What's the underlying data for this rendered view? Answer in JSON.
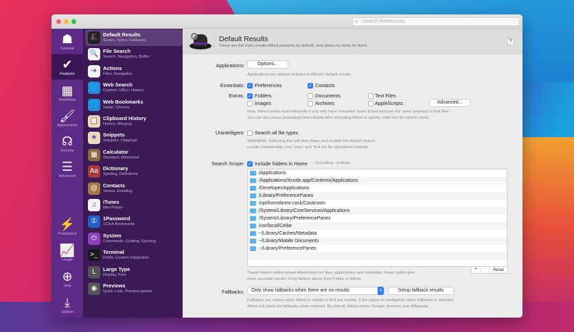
{
  "search": {
    "placeholder": "Search Preferences"
  },
  "iconbar": [
    {
      "label": "General",
      "icon": "hat-icon",
      "glyph": "☗"
    },
    {
      "label": "Features",
      "icon": "checkmark-icon",
      "glyph": "✔"
    },
    {
      "label": "Workflows",
      "icon": "grid-icon",
      "glyph": "▦"
    },
    {
      "label": "Appearance",
      "icon": "paint-roller-icon",
      "glyph": "🖌"
    },
    {
      "label": "Remote",
      "icon": "remote-icon",
      "glyph": "☊"
    },
    {
      "label": "Advanced",
      "icon": "sliders-icon",
      "glyph": "☰"
    },
    {
      "label": "Powerpack",
      "icon": "battery-icon",
      "glyph": "⚡"
    },
    {
      "label": "Usage",
      "icon": "chart-icon",
      "glyph": "📈"
    },
    {
      "label": "Help",
      "icon": "lifebuoy-icon",
      "glyph": "⊕"
    },
    {
      "label": "Update",
      "icon": "download-icon",
      "glyph": "⤓"
    }
  ],
  "features": [
    {
      "title": "Default Results",
      "sub": "Scope, Types, Fallbacks",
      "icon": "alfred-hat-icon",
      "color": "#222222",
      "glyph": "🎩"
    },
    {
      "title": "File Search",
      "sub": "Search, Navigation, Buffer",
      "icon": "file-search-icon",
      "color": "#f2f2f2",
      "glyph": "🔍"
    },
    {
      "title": "Actions",
      "sub": "Files, Navigation",
      "icon": "actions-icon",
      "color": "#f2f2f2",
      "glyph": "➜"
    },
    {
      "title": "Web Search",
      "sub": "Custom, URLs, History",
      "icon": "globe-search-icon",
      "color": "#2a8ad8",
      "glyph": "🌐"
    },
    {
      "title": "Web Bookmarks",
      "sub": "Safari, Chrome",
      "icon": "globe-bookmark-icon",
      "color": "#2a8ad8",
      "glyph": "🌐"
    },
    {
      "title": "Clipboard History",
      "sub": "History, Merging",
      "icon": "clipboard-icon",
      "color": "#e8dcc0",
      "glyph": "📋"
    },
    {
      "title": "Snippets",
      "sub": "Snippets, Clippings",
      "icon": "snippets-icon",
      "color": "#e8dcc0",
      "glyph": "★"
    },
    {
      "title": "Calculator",
      "sub": "Standard, Advanced",
      "icon": "calculator-icon",
      "color": "#8a6a40",
      "glyph": "▦"
    },
    {
      "title": "Dictionary",
      "sub": "Spelling, Definitions",
      "icon": "dictionary-icon",
      "color": "#a83a3a",
      "glyph": "Aa"
    },
    {
      "title": "Contacts",
      "sub": "Viewer, Emailing",
      "icon": "contacts-icon",
      "color": "#a07a40",
      "glyph": "@"
    },
    {
      "title": "iTunes",
      "sub": "Mini Player",
      "icon": "itunes-icon",
      "color": "#f4f4f4",
      "glyph": "♫"
    },
    {
      "title": "1Password",
      "sub": "1Click Bookmarks",
      "icon": "1password-icon",
      "color": "#2060c0",
      "glyph": "①"
    },
    {
      "title": "System",
      "sub": "Commands, Quitting, Ejecting",
      "icon": "power-icon",
      "color": "#9040c0",
      "glyph": "⏻"
    },
    {
      "title": "Terminal",
      "sub": "Prefix, Custom Integration",
      "icon": "terminal-icon",
      "color": "#1a1a1a",
      "glyph": ">_"
    },
    {
      "title": "Large Type",
      "sub": "Display, Font",
      "icon": "large-type-icon",
      "color": "#555555",
      "glyph": "L"
    },
    {
      "title": "Previews",
      "sub": "Quick Look, Preview panels",
      "icon": "eye-icon",
      "color": "#555555",
      "glyph": "◉"
    }
  ],
  "header": {
    "title": "Default Results",
    "subtitle": "These are the main results Alfred presents by default, and where he looks for them.",
    "help": "?"
  },
  "applications": {
    "label": "Applications:",
    "button": "Options...",
    "note": "Applications are always included in Alfred's default results."
  },
  "essentials": {
    "label": "Essentials:",
    "items": [
      {
        "label": "Preferences",
        "checked": true
      },
      {
        "label": "Contacts",
        "checked": true
      }
    ]
  },
  "extras": {
    "label": "Extras:",
    "items": [
      {
        "label": "Folders",
        "checked": true
      },
      {
        "label": "Documents",
        "checked": false
      },
      {
        "label": "Text Files",
        "checked": false
      },
      {
        "label": "Images",
        "checked": false
      },
      {
        "label": "Archives",
        "checked": false
      },
      {
        "label": "AppleScripts",
        "checked": false
      }
    ],
    "button": "Advanced...",
    "note1": "Note: Alfred works most efficiently if you only have 'essential' items ticked and use the 'open' keyword to find files.",
    "note2": "You can also press [spacebar] immediately after activating Alfred to quickly enter the file search mode."
  },
  "unintelligent": {
    "label": "Unintelligent:",
    "checkbox": "Search all file types",
    "checked": false,
    "note1": "WARNING: Selecting this will slow down and muddle the default search",
    "note2": "results considerably. Use 'open' and 'find' for file operations instead."
  },
  "scope": {
    "label": "Search Scope:",
    "checkbox": "Include folders in Home",
    "checked": true,
    "excluding": "- Excluding ~/Library",
    "paths": [
      "/Applications",
      "/Applications/Xcode.app/Contents/Applications",
      "/Developer/Applications",
      "/Library/PreferencePanes",
      "/opt/homebrew-cask/Caskroom",
      "/System/Library/CoreServices/Applications",
      "/System/Library/PreferencePanes",
      "/usr/local/Cellar",
      "~/Library/Caches/Metadata",
      "~/Library/Mobile Documents",
      "~/Library/PreferencePanes"
    ],
    "add": "+",
    "remove": "−",
    "reset": "Reset",
    "note1": "These folders define where Alfred looks for files, applications and metadata. Fewer paths give",
    "note2": "more accurate results. Drop folders above from Finder or Alfred."
  },
  "fallbacks": {
    "label": "Fallbacks:",
    "select": "Only show fallbacks when there are no results",
    "button": "Setup fallback results",
    "note1": "Fallbacks are shown when Alfred is unable to find any results. If the option to intelligently show fallbacks is selected,",
    "note2": "Alfred will show the fallbacks when relevant. By default, Alfred shows Google, Amazon and Wikipedia."
  }
}
